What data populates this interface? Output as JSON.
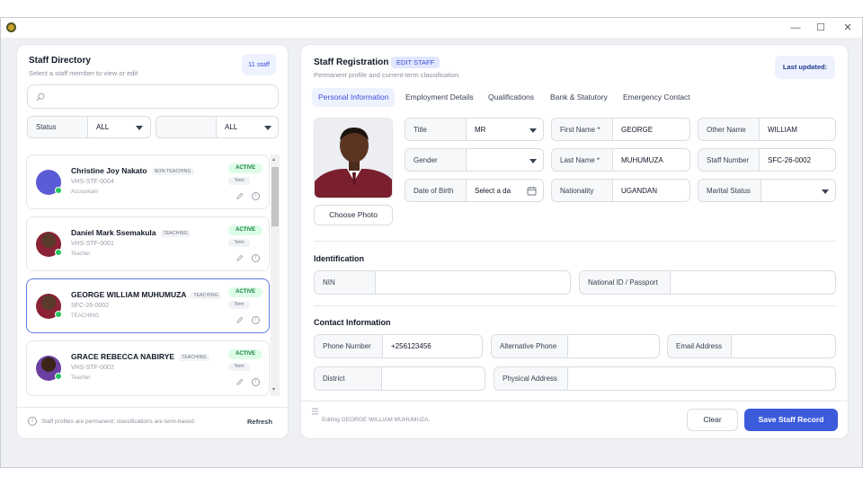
{
  "window": {
    "controls": {
      "minimize": "—",
      "maximize": "☐",
      "close": "✕"
    }
  },
  "directory": {
    "title": "Staff Directory",
    "subtitle": "Select a staff member to view or edit",
    "count": "11  staff",
    "search_placeholder": "",
    "filter1": {
      "label": "Status",
      "value": "ALL"
    },
    "filter2": {
      "label": "",
      "value": "ALL"
    },
    "cards": [
      {
        "name": "Christine Joy Nakato",
        "type": "NON-TEACHING",
        "id": "VHS-STF-0004",
        "role": "Accountant",
        "status": "ACTIVE",
        "term": "Term",
        "selected": false
      },
      {
        "name": "Daniel Mark Ssemakula",
        "type": "TEACHING",
        "id": "VHS-STF-0001",
        "role": "Teacher",
        "status": "ACTIVE",
        "term": "Term",
        "selected": false
      },
      {
        "name": "GEORGE WILLIAM MUHUMUZA",
        "type": "TEACHING",
        "id": "SFC-26-0002",
        "role": "TEACHING",
        "status": "ACTIVE",
        "term": "Term",
        "selected": true
      },
      {
        "name": "GRACE REBECCA NABIRYE",
        "type": "TEACHING",
        "id": "VHS-STF-0002",
        "role": "Teacher",
        "status": "ACTIVE",
        "term": "Term",
        "selected": false
      }
    ],
    "footer_note": "Staff profiles are permanent; classifications are term-based.",
    "refresh_label": "Refresh"
  },
  "registration": {
    "title": "Staff Registration",
    "mode_badge": "EDIT STAFF",
    "subtitle": "Permanent profile and current-term classification",
    "last_updated_label": "Last updated:",
    "tabs": [
      "Personal Information",
      "Employment Details",
      "Qualifications",
      "Bank & Statutory",
      "Emergency Contact"
    ],
    "active_tab": "Personal Information",
    "choose_photo": "Choose Photo",
    "fields": {
      "title": {
        "label": "Title",
        "value": "MR"
      },
      "first_name": {
        "label": "First Name *",
        "value": "GEORGE"
      },
      "other_name": {
        "label": "Other Name",
        "value": "WILLIAM"
      },
      "gender": {
        "label": "Gender",
        "value": ""
      },
      "last_name": {
        "label": "Last Name *",
        "value": "MUHUMUZA"
      },
      "staff_number": {
        "label": "Staff Number",
        "value": "SFC-26-0002"
      },
      "dob": {
        "label": "Date of Birth",
        "value": "Select a da"
      },
      "nationality": {
        "label": "Nationality",
        "value": "UGANDAN"
      },
      "marital_status": {
        "label": "Marital Status",
        "value": ""
      }
    },
    "identification": {
      "title": "Identification",
      "nin": {
        "label": "NIN",
        "value": ""
      },
      "national_id": {
        "label": "National ID / Passport",
        "value": ""
      }
    },
    "contact": {
      "title": "Contact Information",
      "phone": {
        "label": "Phone Number",
        "value": "+256123456"
      },
      "alt_phone": {
        "label": "Alternative Phone",
        "value": ""
      },
      "email": {
        "label": "Email Address",
        "value": ""
      },
      "district": {
        "label": "District",
        "value": ""
      },
      "address": {
        "label": "Physical Address",
        "value": ""
      }
    },
    "status_text": "Editing GEORGE WILLIAM MUHUMUZA.",
    "clear_label": "Clear",
    "save_label": "Save Staff Record"
  },
  "colors": {
    "accent": "#3b5bdb",
    "active_green": "#22c55e"
  },
  "icons": {
    "search": "search-icon",
    "calendar": "calendar-icon",
    "info": "info-icon",
    "edit": "edit-icon"
  }
}
